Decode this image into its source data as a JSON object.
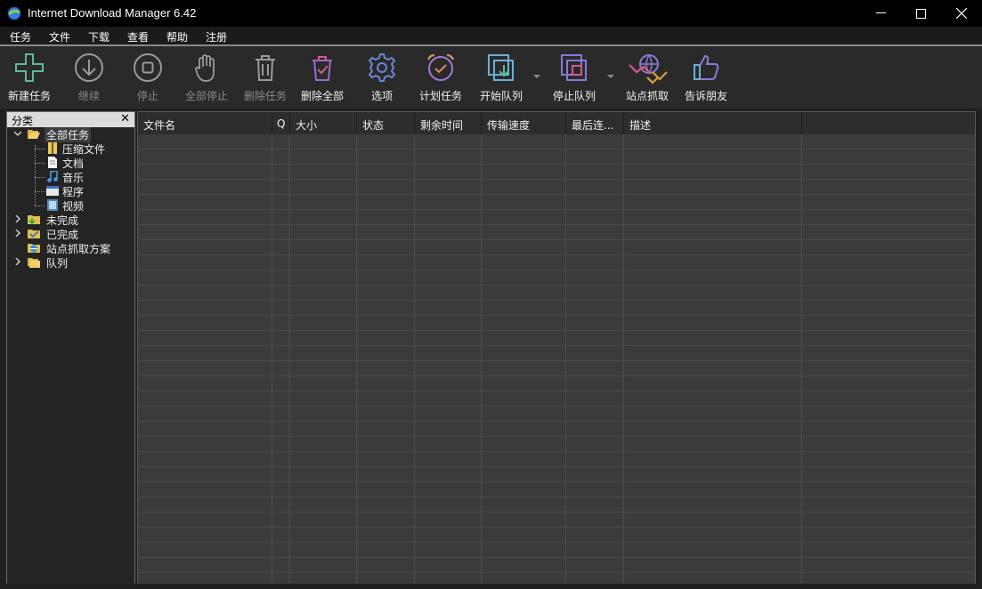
{
  "window": {
    "title": "Internet Download Manager 6.42"
  },
  "menu": [
    "任务",
    "文件",
    "下载",
    "查看",
    "帮助",
    "注册"
  ],
  "toolbar": [
    {
      "label": "新建任务",
      "icon": "plus-icon",
      "enabled": true
    },
    {
      "label": "继续",
      "icon": "download-arrow-icon",
      "enabled": false
    },
    {
      "label": "停止",
      "icon": "stop-icon",
      "enabled": false
    },
    {
      "label": "全部停止",
      "icon": "hand-icon",
      "enabled": false
    },
    {
      "label": "删除任务",
      "icon": "trash-icon",
      "enabled": false
    },
    {
      "label": "删除全部",
      "icon": "trash-check-icon",
      "enabled": true
    },
    {
      "label": "选项",
      "icon": "gear-icon",
      "enabled": true
    },
    {
      "label": "计划任务",
      "icon": "alarm-clock-icon",
      "enabled": true
    },
    {
      "label": "开始队列",
      "icon": "start-queue-icon",
      "enabled": true
    },
    {
      "label": "停止队列",
      "icon": "stop-queue-icon",
      "enabled": true
    },
    {
      "label": "站点抓取",
      "icon": "site-grabber-icon",
      "enabled": true
    },
    {
      "label": "告诉朋友",
      "icon": "thumbs-up-icon",
      "enabled": true
    }
  ],
  "sidebar": {
    "header": "分类",
    "close": "✕",
    "tree": [
      {
        "label": "全部任务",
        "icon": "folder-open-icon",
        "expanded": true,
        "children": [
          {
            "label": "压缩文件",
            "icon": "archive-icon"
          },
          {
            "label": "文档",
            "icon": "document-icon"
          },
          {
            "label": "音乐",
            "icon": "music-icon"
          },
          {
            "label": "程序",
            "icon": "program-icon"
          },
          {
            "label": "视频",
            "icon": "video-icon"
          }
        ]
      },
      {
        "label": "未完成",
        "icon": "folder-unfinished-icon",
        "expanded": false
      },
      {
        "label": "已完成",
        "icon": "folder-finished-icon",
        "expanded": false
      },
      {
        "label": "站点抓取方案",
        "icon": "grabber-folder-icon",
        "expanded": false
      },
      {
        "label": "队列",
        "icon": "folder-queue-icon",
        "expanded": false
      }
    ]
  },
  "grid": {
    "columns": [
      "文件名",
      "Q",
      "大小",
      "状态",
      "剩余时间",
      "传输速度",
      "最后连...",
      "描述",
      ""
    ],
    "rows": []
  },
  "colors": {
    "background": "#202020",
    "grid": "#3b3b3b",
    "accent_plus": "#5fb89a",
    "accent_gear": "#6b84d6"
  }
}
